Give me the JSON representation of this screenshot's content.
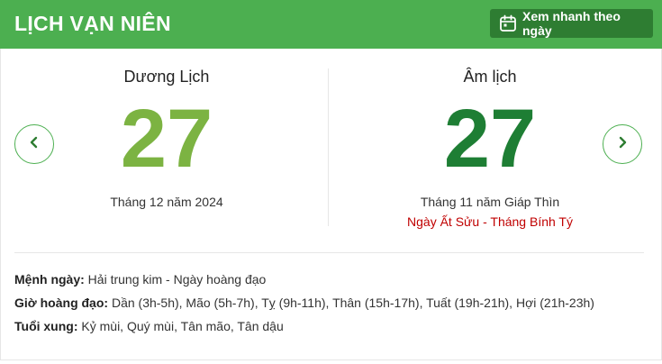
{
  "header": {
    "title": "LỊCH VẠN NIÊN",
    "quick_view_label": "Xem nhanh theo ngày",
    "background": "#4caf50",
    "button_background": "#2e7d32"
  },
  "solar": {
    "title": "Dương Lịch",
    "day": "27",
    "month_year": "Tháng 12 năm 2024",
    "color": "#7cb342"
  },
  "lunar": {
    "title": "Âm lịch",
    "day": "27",
    "month_year": "Tháng 11 năm Giáp Thìn",
    "can_chi": "Ngày Ất Sửu - Tháng Bính Tý",
    "color": "#1e7e34",
    "can_chi_color": "#c00000"
  },
  "nav": {
    "prev_icon": "chevron-left-icon",
    "next_icon": "chevron-right-icon"
  },
  "details": {
    "menh_label": "Mệnh ngày:",
    "menh_value": "Hải trung kim - Ngày hoàng đạo",
    "gio_label": "Giờ hoàng đạo:",
    "gio_value": "Dần (3h-5h), Mão (5h-7h), Tỵ (9h-11h), Thân (15h-17h), Tuất (19h-21h), Hợi (21h-23h)",
    "tuoi_label": "Tuổi xung:",
    "tuoi_value": "Kỷ mùi, Quý mùi, Tân mão, Tân dậu"
  }
}
